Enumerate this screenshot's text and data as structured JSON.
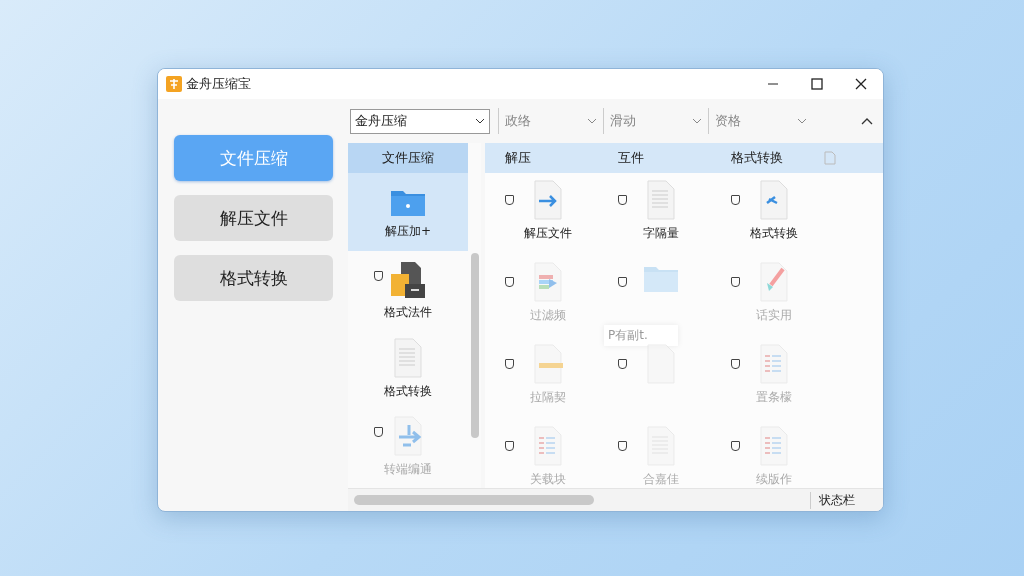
{
  "window": {
    "title": "金舟压缩宝"
  },
  "sidebar": {
    "items": [
      {
        "label": "文件压缩",
        "selected": true
      },
      {
        "label": "解压文件",
        "selected": false
      },
      {
        "label": "格式转换",
        "selected": false
      }
    ]
  },
  "toolbar": {
    "dropdown": {
      "value": "金舟压缩"
    },
    "filters": [
      {
        "label": "政络"
      },
      {
        "label": "滑动"
      },
      {
        "label": "资格"
      }
    ]
  },
  "list": {
    "header": "文件压缩",
    "items": [
      {
        "label": "解压加+",
        "kind": "folder",
        "selected": true,
        "checkbox": false,
        "disabled": false
      },
      {
        "label": "格式法件",
        "kind": "archive",
        "selected": false,
        "checkbox": true,
        "disabled": false
      },
      {
        "label": "格式转换",
        "kind": "lines",
        "selected": false,
        "checkbox": false,
        "disabled": false
      },
      {
        "label": "转端编通",
        "kind": "split",
        "selected": false,
        "checkbox": true,
        "disabled": true
      }
    ]
  },
  "grid": {
    "header": [
      "解压",
      "互件",
      "格式转换"
    ],
    "items": [
      {
        "label": "解压文件",
        "kind": "arrow",
        "checkbox": true,
        "disabled": false
      },
      {
        "label": "字隔量",
        "kind": "lines",
        "checkbox": true,
        "disabled": false
      },
      {
        "label": "格式转换",
        "kind": "swap",
        "checkbox": true,
        "disabled": false
      },
      {
        "label": "过滤频",
        "kind": "ribbon",
        "checkbox": true,
        "disabled": true
      },
      {
        "kind": "folder",
        "checkbox": true,
        "disabled": true,
        "tooltip": "P有副t."
      },
      {
        "label": "话实用",
        "kind": "brush",
        "checkbox": true,
        "disabled": true
      },
      {
        "label": "拉隔契",
        "kind": "bar",
        "checkbox": true,
        "disabled": true
      },
      {
        "kind": "blank",
        "checkbox": true,
        "disabled": true
      },
      {
        "label": "置条檬",
        "kind": "table",
        "checkbox": true,
        "disabled": true
      },
      {
        "label": "关载块",
        "kind": "table",
        "checkbox": true,
        "disabled": true
      },
      {
        "label": "合嘉佳",
        "kind": "lines",
        "checkbox": true,
        "disabled": true
      },
      {
        "label": "续版作",
        "kind": "table",
        "checkbox": true,
        "disabled": true
      }
    ]
  },
  "status_bar": {
    "text": "状态栏"
  }
}
